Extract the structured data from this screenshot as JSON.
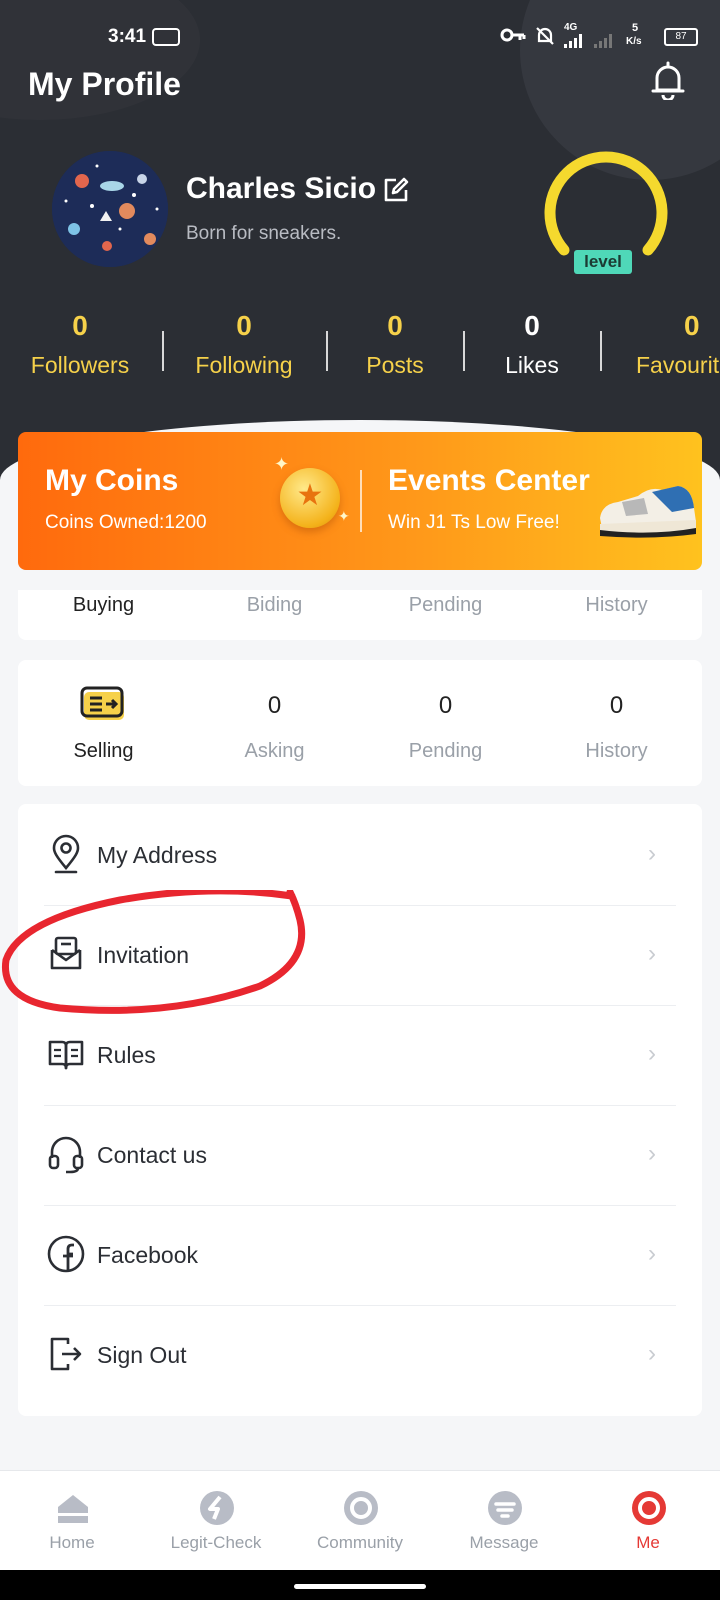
{
  "status_bar": {
    "time": "3:41",
    "net_badge": "4G",
    "speed_top": "5",
    "speed_bottom": "K/s",
    "battery": "87"
  },
  "header": {
    "title": "My Profile"
  },
  "profile": {
    "name": "Charles Sicio",
    "bio": "Born for sneakers.",
    "level_label": "level"
  },
  "stats": [
    {
      "value": "0",
      "label": "Followers"
    },
    {
      "value": "0",
      "label": "Following"
    },
    {
      "value": "0",
      "label": "Posts"
    },
    {
      "value": "0",
      "label": "Likes"
    },
    {
      "value": "0",
      "label": "Favourit"
    }
  ],
  "promo": {
    "coins_title": "My Coins",
    "coins_sub": "Coins Owned:1200",
    "events_title": "Events Center",
    "events_sub": "Win J1 Ts Low Free!"
  },
  "buying": {
    "tabs": [
      "Buying",
      "Biding",
      "Pending",
      "History"
    ]
  },
  "selling": {
    "label": "Selling",
    "cells": [
      {
        "value": "0",
        "label": "Asking"
      },
      {
        "value": "0",
        "label": "Pending"
      },
      {
        "value": "0",
        "label": "History"
      }
    ]
  },
  "menu": {
    "items": [
      {
        "label": "My Address",
        "icon": "location-pin-icon"
      },
      {
        "label": "Invitation",
        "icon": "envelope-icon"
      },
      {
        "label": "Rules",
        "icon": "book-icon"
      },
      {
        "label": "Contact us",
        "icon": "headset-icon"
      },
      {
        "label": "Facebook",
        "icon": "facebook-icon"
      },
      {
        "label": "Sign Out",
        "icon": "sign-out-icon"
      }
    ]
  },
  "tabbar": {
    "items": [
      {
        "label": "Home",
        "icon": "home-icon"
      },
      {
        "label": "Legit-Check",
        "icon": "legit-check-icon"
      },
      {
        "label": "Community",
        "icon": "community-icon"
      },
      {
        "label": "Message",
        "icon": "message-icon"
      },
      {
        "label": "Me",
        "icon": "me-icon",
        "active": true
      }
    ]
  },
  "colors": {
    "accent_yellow": "#f6d14a",
    "active_red": "#e53935",
    "header_bg": "#2b2e34",
    "annotation_red": "#e8262f"
  }
}
